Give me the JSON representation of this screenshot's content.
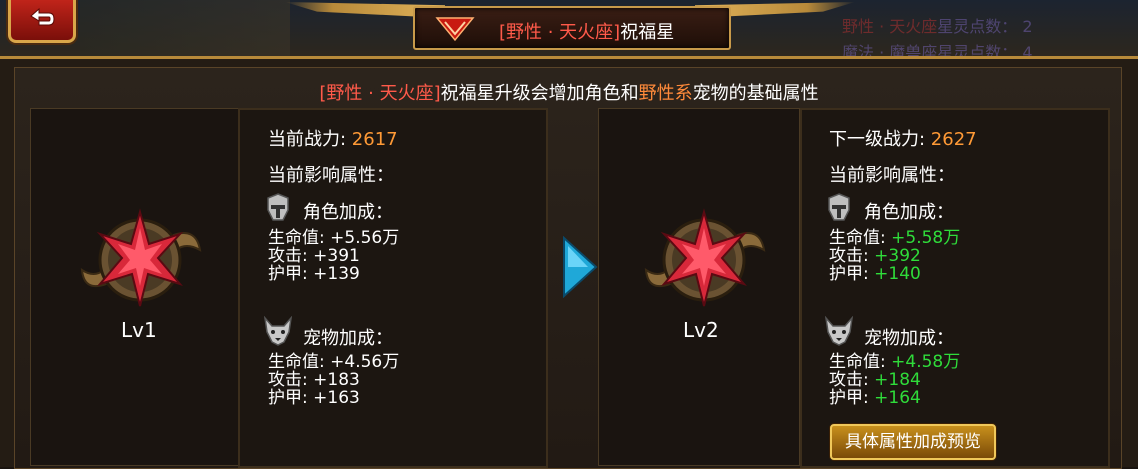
{
  "title": {
    "prefix": "[野性 · 天火座]",
    "suffix": "祝福星"
  },
  "topright": {
    "line1_red": "野性 · 天火座",
    "line1_rest": "星灵点数：",
    "line1_value": "2",
    "line2_red": "魔法 · 魔兽座",
    "line2_rest": "星灵点数：",
    "line2_value": "4"
  },
  "header": {
    "part1": "[野性 · 天火座]",
    "part2": "祝福星升级会增加角色和",
    "part3": "野性系",
    "part4": "宠物的基础属性"
  },
  "current": {
    "level": "Lv1",
    "power_label": "当前战力: ",
    "power_value": "2617",
    "attr_label": "当前影响属性：",
    "role_label": "角色加成：",
    "role_hp": "生命值: +5.56万",
    "role_atk": "攻击: +391",
    "role_def": "护甲: +139",
    "pet_label": "宠物加成：",
    "pet_hp": "生命值: +4.56万",
    "pet_atk": "攻击: +183",
    "pet_def": "护甲: +163"
  },
  "next": {
    "level": "Lv2",
    "power_label": "下一级战力: ",
    "power_value": "2627",
    "attr_label": "当前影响属性：",
    "role_label": "角色加成：",
    "hp_label": "生命值: ",
    "atk_label": "攻击: ",
    "def_label": "护甲: ",
    "role_hp": "+5.58万",
    "role_atk": "+392",
    "role_def": "+140",
    "pet_label": "宠物加成：",
    "pet_hp": "+4.58万",
    "pet_atk": "+184",
    "pet_def": "+164"
  },
  "preview_button": "具体属性加成预览",
  "colors": {
    "red": "#ff5a4a",
    "orange": "#ff9a36",
    "green": "#2fdc3a",
    "gold": "#c89a4a",
    "cyan_arrow": "#1fa8d8"
  },
  "icons": [
    "back-arrow-icon",
    "constellation-emblem-icon",
    "star-medal-icon",
    "helmet-icon",
    "wolf-head-icon",
    "next-arrow-icon"
  ]
}
